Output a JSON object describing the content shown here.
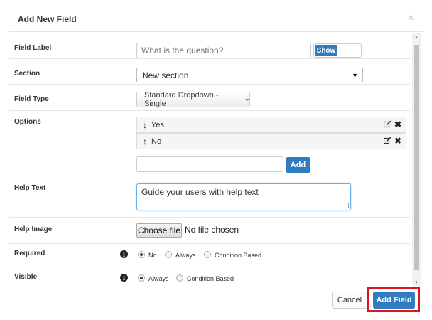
{
  "dialog": {
    "title": "Add New Field",
    "close_symbol": "×"
  },
  "fields": {
    "field_label": {
      "label": "Field Label",
      "placeholder": "What is the question?",
      "show_button": "Show"
    },
    "section": {
      "label": "Section",
      "selected": "New section"
    },
    "field_type": {
      "label": "Field Type",
      "selected": "Standard Dropdown - Single"
    },
    "options": {
      "label": "Options",
      "items": [
        {
          "text": "Yes"
        },
        {
          "text": "No"
        }
      ],
      "add_button": "Add"
    },
    "help_text": {
      "label": "Help Text",
      "value": "Guide your users with help text"
    },
    "help_image": {
      "label": "Help Image",
      "choose_button": "Choose file",
      "status": "No file chosen"
    },
    "required": {
      "label": "Required",
      "choices": [
        "No",
        "Always",
        "Condition Based"
      ],
      "selected": "No"
    },
    "visible": {
      "label": "Visible",
      "choices": [
        "Always",
        "Condition Based"
      ],
      "selected": "Always"
    }
  },
  "footer": {
    "cancel": "Cancel",
    "submit": "Add Field"
  },
  "icons": {
    "drag": "↕",
    "edit": "edit-icon",
    "delete": "✖",
    "info": "i",
    "dropdown_caret": "▼"
  },
  "colors": {
    "primary": "#2f7cc1",
    "highlight": "#e0141e"
  }
}
